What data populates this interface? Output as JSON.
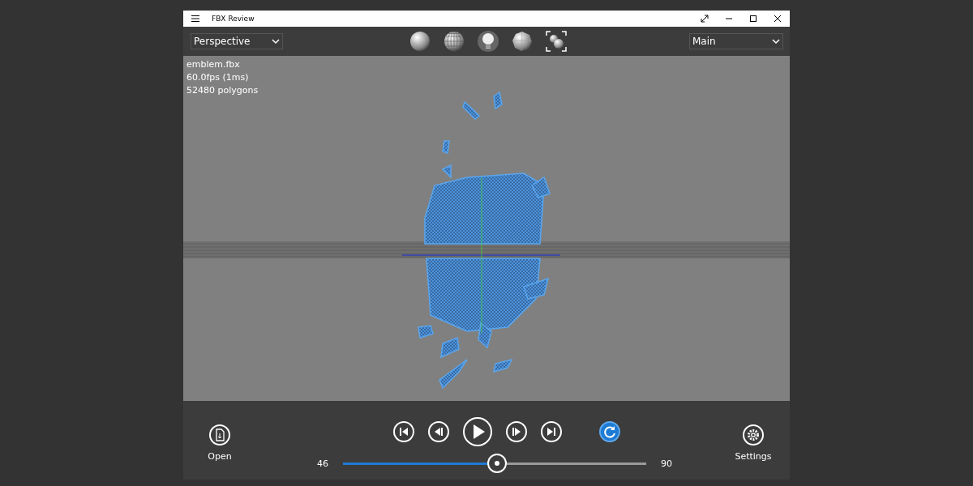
{
  "window": {
    "title": "FBX Review"
  },
  "toolbar": {
    "camera": {
      "value": "Perspective"
    },
    "layer": {
      "value": "Main"
    }
  },
  "viewport": {
    "stats": [
      "emblem.fbx",
      "60.0fps (1ms)",
      "52480 polygons"
    ]
  },
  "playback": {
    "open_label": "Open",
    "start_frame": "46",
    "end_frame": "90",
    "timeline": {
      "level": 0.505
    },
    "loop": {
      "on": true
    },
    "settings_label": "Settings"
  }
}
